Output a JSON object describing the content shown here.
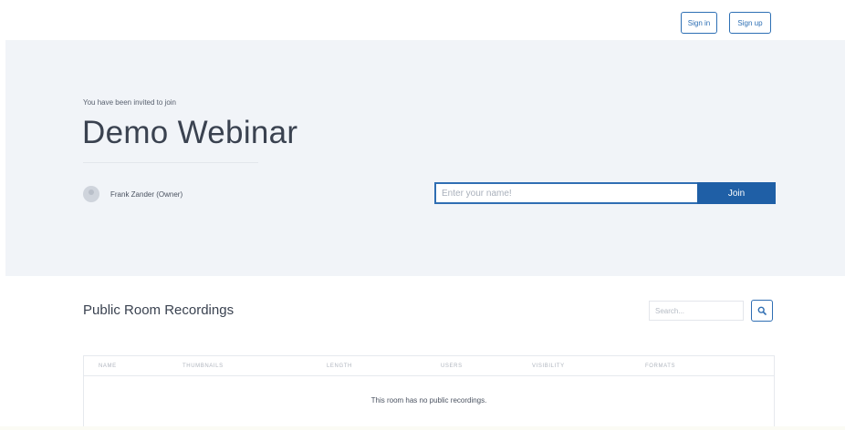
{
  "header": {
    "signin_label": "Sign in",
    "signup_label": "Sign up"
  },
  "room": {
    "invite_text": "You have been invited to join",
    "name": "Demo Webinar",
    "owner": "Frank Zander (Owner)",
    "name_placeholder": "Enter your name!",
    "join_label": "Join"
  },
  "recordings": {
    "title": "Public Room Recordings",
    "search_placeholder": "Search...",
    "columns": [
      "NAME",
      "THUMBNAILS",
      "LENGTH",
      "USERS",
      "VISIBILITY",
      "FORMATS"
    ],
    "empty_message": "This room has no public recordings."
  },
  "colors": {
    "accent": "#1f5fa6",
    "hero_bg": "#f1f4f8"
  },
  "icons": {
    "search": "search-icon"
  }
}
